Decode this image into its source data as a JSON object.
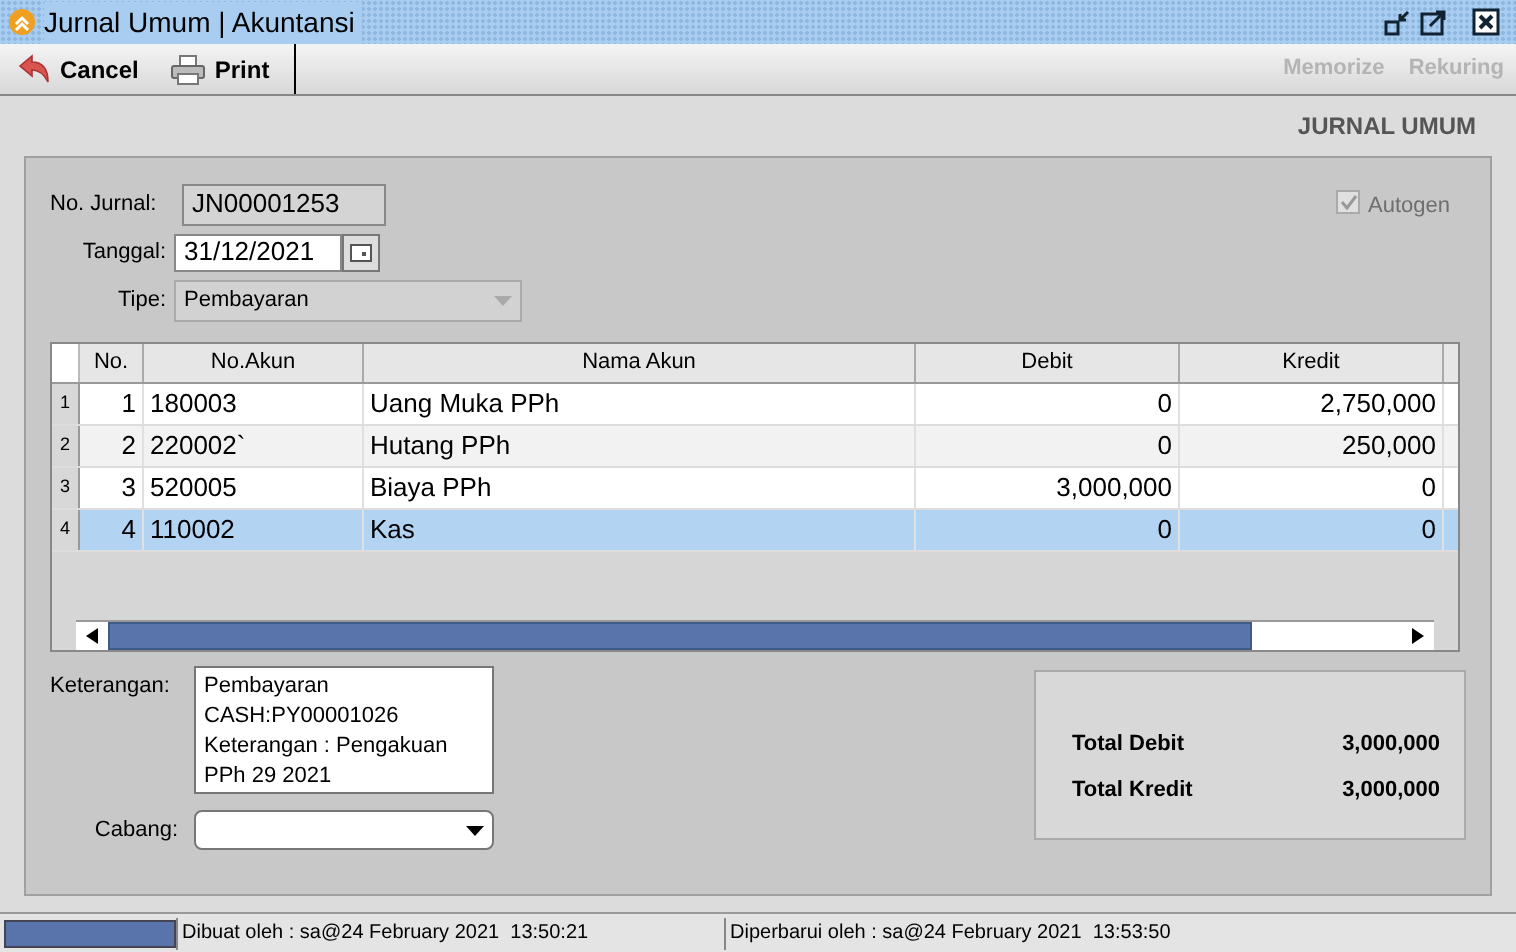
{
  "window": {
    "title": "Jurnal Umum | Akuntansi"
  },
  "toolbar": {
    "left": [
      {
        "label": "Cancel",
        "kind": "cancel"
      },
      {
        "label": "Print",
        "kind": "print"
      }
    ],
    "right": [
      {
        "label": "Memorize",
        "disabled": true
      },
      {
        "label": "Rekuring",
        "disabled": true
      }
    ]
  },
  "heading": "JURNAL UMUM",
  "form": {
    "no_jurnal": {
      "label": "No. Jurnal:",
      "value": "JN00001253"
    },
    "tanggal": {
      "label": "Tanggal:",
      "value": "31/12/2021"
    },
    "tipe": {
      "label": "Tipe:",
      "value": "Pembayaran",
      "disabled": true
    },
    "autogen": {
      "label": "Autogen",
      "checked": true,
      "disabled": true
    }
  },
  "table": {
    "columns": [
      "No.",
      "No.Akun",
      "Nama Akun",
      "Debit",
      "Kredit"
    ],
    "rows": [
      {
        "row_header": "1",
        "cells": [
          "1",
          "180003",
          "Uang Muka PPh",
          "0",
          "2,750,000"
        ],
        "selected": false
      },
      {
        "row_header": "2",
        "cells": [
          "2",
          "220002`",
          "Hutang PPh",
          "0",
          "250,000"
        ],
        "selected": false
      },
      {
        "row_header": "3",
        "cells": [
          "3",
          "520005",
          "Biaya PPh",
          "3,000,000",
          "0"
        ],
        "selected": false
      },
      {
        "row_header": "4",
        "cells": [
          "4",
          "110002",
          "Kas",
          "0",
          "0"
        ],
        "selected": true
      }
    ]
  },
  "keterangan": {
    "label": "Keterangan:",
    "value": "Pembayaran\nCASH:PY00001026\nKeterangan : Pengakuan\nPPh 29 2021"
  },
  "cabang": {
    "label": "Cabang:"
  },
  "totals": [
    {
      "label": "Total Debit",
      "value": "3,000,000"
    },
    {
      "label": "Total Kredit",
      "value": "3,000,000"
    }
  ],
  "status_bar": [
    "Dibuat oleh : sa@24 February 2021  13:50:21",
    "Diperbarui oleh : sa@24 February 2021  13:53:50"
  ]
}
